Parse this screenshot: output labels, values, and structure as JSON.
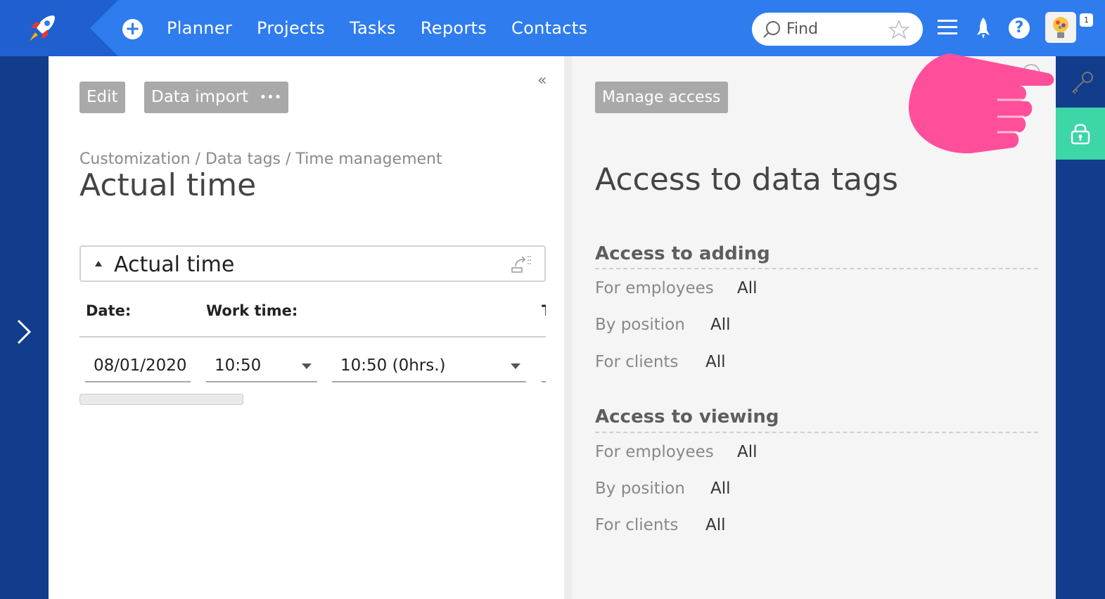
{
  "topbar": {
    "nav": [
      "Planner",
      "Projects",
      "Tasks",
      "Reports",
      "Contacts"
    ],
    "search_placeholder": "Find",
    "notification_count": "1"
  },
  "left": {
    "buttons": {
      "edit": "Edit",
      "import": "Data import",
      "more": "•••"
    },
    "breadcrumb": "Customization / Data tags / Time management",
    "title": "Actual time",
    "section_title": "Actual time",
    "columns": [
      "Date:",
      "Work time:",
      "T"
    ],
    "row": {
      "date": "08/01/2020",
      "work_time": "10:50",
      "third": "10:50 (0hrs.)"
    }
  },
  "right": {
    "manage_button": "Manage access",
    "title": "Access to data tags",
    "groups": [
      {
        "title": "Access to adding",
        "rows": [
          {
            "label": "For employees",
            "value": "All"
          },
          {
            "label": "By position",
            "value": "All"
          },
          {
            "label": "For clients",
            "value": "All"
          }
        ]
      },
      {
        "title": "Access to viewing",
        "rows": [
          {
            "label": "For employees",
            "value": "All"
          },
          {
            "label": "By position",
            "value": "All"
          },
          {
            "label": "For clients",
            "value": "All"
          }
        ]
      }
    ]
  },
  "colors": {
    "topbar": "#2f7cef",
    "rail": "#123d8c",
    "lock_tab": "#3dd6a7",
    "pointer": "#ff4f9a"
  },
  "icons": [
    "rocket-logo-icon",
    "plus-icon",
    "search-icon",
    "star-icon",
    "menu-icon",
    "rocket-icon",
    "help-icon",
    "chevron-right-icon",
    "double-chevron-left-icon",
    "export-icon",
    "close-icon",
    "key-icon",
    "lock-icon",
    "pointing-hand-icon"
  ]
}
